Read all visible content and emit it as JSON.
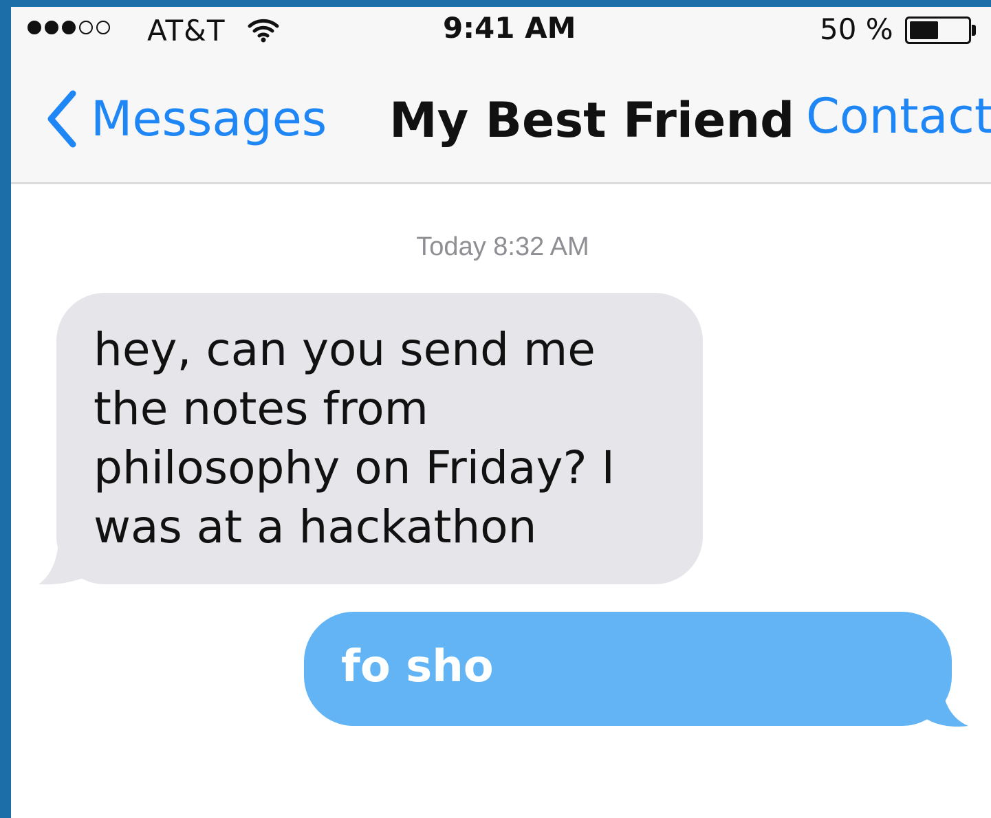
{
  "status_bar": {
    "signal_dots": [
      "full",
      "full",
      "full",
      "empty",
      "empty"
    ],
    "carrier": "AT&T",
    "wifi_icon": "wifi-icon",
    "time": "9:41 AM",
    "battery_percent": "50 %",
    "battery_level": 0.5
  },
  "nav": {
    "back_label": "Messages",
    "back_icon": "chevron-left-icon",
    "title": "My Best Friend",
    "contact_label": "Contact"
  },
  "thread": {
    "timestamp": "Today 8:32 AM",
    "messages": [
      {
        "direction": "incoming",
        "text": "hey, can you send me the notes from philosophy on Friday? I was at a hackathon"
      },
      {
        "direction": "outgoing",
        "text": "fo sho"
      }
    ]
  },
  "colors": {
    "accent": "#1f86f6",
    "incoming_bubble": "#e5e5ea",
    "outgoing_bubble": "#62b4f5",
    "frame": "#1b6ea8"
  }
}
